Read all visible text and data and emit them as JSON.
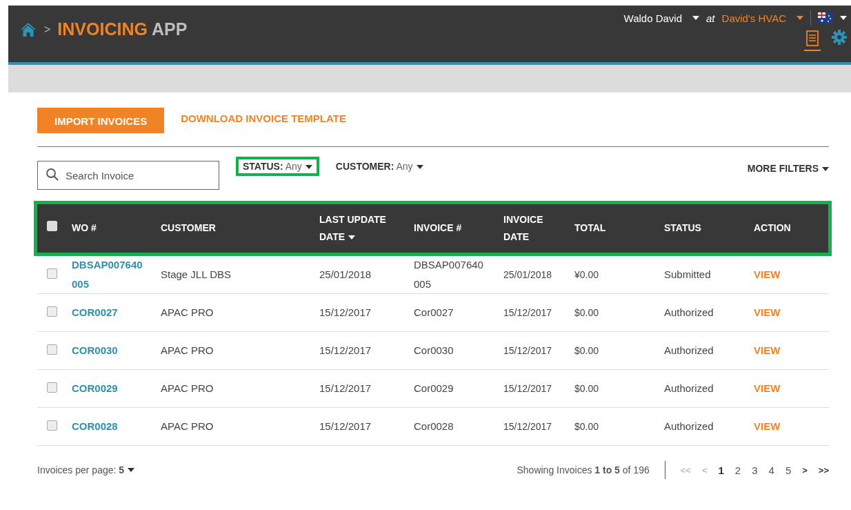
{
  "header": {
    "breadcrumb_separator": ">",
    "app_title": {
      "accent": "INVOICING",
      "rest": "APP"
    },
    "user": "Waldo David",
    "at": "at",
    "company": "David's HVAC"
  },
  "toolbar": {
    "import_button": "IMPORT INVOICES",
    "download_link": "DOWNLOAD INVOICE TEMPLATE"
  },
  "filters": {
    "search": {
      "placeholder": "Search Invoice"
    },
    "status": {
      "label": "STATUS:",
      "value": "Any",
      "highlighted": true
    },
    "customer": {
      "label": "CUSTOMER:",
      "value": "Any",
      "highlighted": false
    },
    "more": "MORE FILTERS"
  },
  "table": {
    "highlighted": true,
    "select_all": false,
    "columns": [
      "WO #",
      "CUSTOMER",
      "LAST UPDATE DATE",
      "INVOICE #",
      "INVOICE DATE",
      "TOTAL",
      "STATUS",
      "ACTION"
    ],
    "rows": [
      {
        "checked": false,
        "cells": [
          "DBSAP007640005",
          "Stage JLL DBS",
          "25/01/2018",
          "DBSAP007640005",
          "25/01/2018",
          "¥0.00",
          "Submitted",
          "VIEW"
        ]
      },
      {
        "checked": false,
        "cells": [
          "COR0027",
          "APAC PRO",
          "15/12/2017",
          "Cor0027",
          "15/12/2017",
          "$0.00",
          "Authorized",
          "VIEW"
        ]
      },
      {
        "checked": false,
        "cells": [
          "COR0030",
          "APAC PRO",
          "15/12/2017",
          "Cor0030",
          "15/12/2017",
          "$0.00",
          "Authorized",
          "VIEW"
        ]
      },
      {
        "checked": false,
        "cells": [
          "COR0029",
          "APAC PRO",
          "15/12/2017",
          "Cor0029",
          "15/12/2017",
          "$0.00",
          "Authorized",
          "VIEW"
        ]
      },
      {
        "checked": false,
        "cells": [
          "COR0028",
          "APAC PRO",
          "15/12/2017",
          "Cor0028",
          "15/12/2017",
          "$0.00",
          "Authorized",
          "VIEW"
        ]
      }
    ]
  },
  "footer": {
    "per_page_label": "Invoices per page:",
    "per_page": "5",
    "showing": "Showing Invoices **1 to 5** of 196",
    "pager": [
      {
        "label": "<<",
        "kind": "nav",
        "disabled": true
      },
      {
        "label": "<",
        "kind": "nav",
        "disabled": true
      },
      {
        "label": "1",
        "kind": "page",
        "selected": true
      },
      {
        "label": "2",
        "kind": "page",
        "selected": false
      },
      {
        "label": "3",
        "kind": "page",
        "selected": false
      },
      {
        "label": "4",
        "kind": "page",
        "selected": false
      },
      {
        "label": "5",
        "kind": "page",
        "selected": false
      },
      {
        "label": ">",
        "kind": "nav",
        "disabled": false
      },
      {
        "label": ">>",
        "kind": "nav",
        "disabled": false
      }
    ]
  }
}
